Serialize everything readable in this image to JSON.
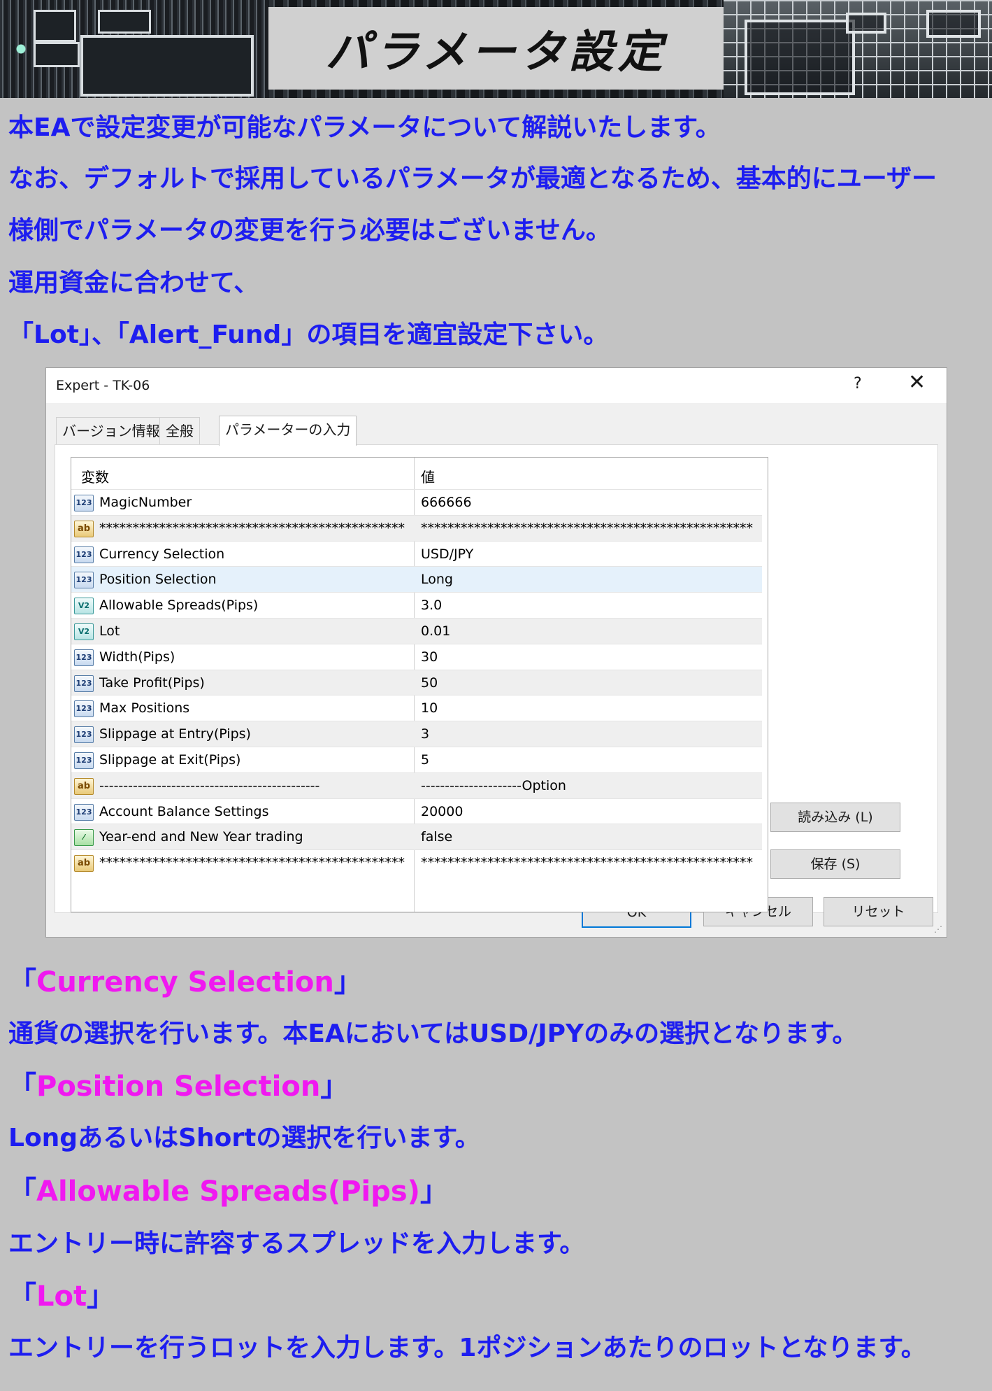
{
  "banner": {
    "title": "パラメータ設定"
  },
  "intro": {
    "l1_a": "本",
    "l1_b": "EA",
    "l1_c": "で設定変更が可能なパラメータについて解説いたします。",
    "l2": "なお、デフォルトで採用しているパラメータが最適となるため、基本的にユーザー",
    "l3": "様側でパラメータの変更を行う必要はございません。",
    "l4": "運用資金に合わせて、",
    "l5_a": "「",
    "l5_b": "Lot",
    "l5_c": "」、「",
    "l5_d": "Alert_Fund",
    "l5_e": "」の項目を適宜設定下さい。"
  },
  "dialog": {
    "title": "Expert - TK-06",
    "help_glyph": "?",
    "close_glyph": "✕",
    "tabs": [
      "バージョン情報",
      "全般",
      "パラメーターの入力"
    ],
    "columns": {
      "variable": "変数",
      "value": "値"
    },
    "rows": [
      {
        "icon": "123",
        "name": "MagicNumber",
        "value": "666666"
      },
      {
        "icon": "ab",
        "name": "**********************************************",
        "value": "**************************************************"
      },
      {
        "icon": "123",
        "name": "Currency Selection",
        "value": "USD/JPY"
      },
      {
        "icon": "123",
        "name": "Position Selection",
        "value": "Long"
      },
      {
        "icon": "v2",
        "name": "Allowable Spreads(Pips)",
        "value": "3.0"
      },
      {
        "icon": "v2",
        "name": "Lot",
        "value": "0.01"
      },
      {
        "icon": "123",
        "name": "Width(Pips)",
        "value": "30"
      },
      {
        "icon": "123",
        "name": "Take Profit(Pips)",
        "value": "50"
      },
      {
        "icon": "123",
        "name": "Max Positions",
        "value": "10"
      },
      {
        "icon": "123",
        "name": "Slippage at Entry(Pips)",
        "value": "3"
      },
      {
        "icon": "123",
        "name": "Slippage at Exit(Pips)",
        "value": "5"
      },
      {
        "icon": "ab",
        "name": "----------------------------------------------",
        "value": "---------------------Option"
      },
      {
        "icon": "123",
        "name": "Account Balance Settings",
        "value": "20000"
      },
      {
        "icon": "bool",
        "name": "Year-end and New Year trading",
        "value": "false"
      },
      {
        "icon": "ab",
        "name": "**********************************************",
        "value": "**************************************************"
      }
    ],
    "icon_labels": {
      "i123": "123",
      "ab": "ab",
      "v2": "V2",
      "bool": "⁄"
    },
    "buttons": {
      "load": "読み込み (L)",
      "save": "保存 (S)",
      "ok": "OK",
      "cancel": "キャンセル",
      "reset": "リセット"
    }
  },
  "sections": [
    {
      "open": "「",
      "heading": "Currency Selection",
      "close": "」",
      "desc_a": "通貨の選択を行います。本",
      "desc_b": "EA",
      "desc_c": "においては",
      "desc_d": "USD/JPY",
      "desc_e": "のみの選択となります。"
    },
    {
      "open": "「",
      "heading": "Position Selection",
      "close": "」",
      "desc_a": "Long",
      "desc_b": "あるいは",
      "desc_c": "Short",
      "desc_d": "の選択を行います。"
    },
    {
      "open": "「",
      "heading": "Allowable Spreads(Pips)",
      "close": "」",
      "desc_a": "エントリー時に許容するスプレッドを入力します。"
    },
    {
      "open": "「",
      "heading": "Lot",
      "close": "」",
      "desc_a": "エントリーを行うロットを入力します。",
      "desc_b": "1",
      "desc_c": "ポジションあたりのロットとなります。"
    }
  ]
}
